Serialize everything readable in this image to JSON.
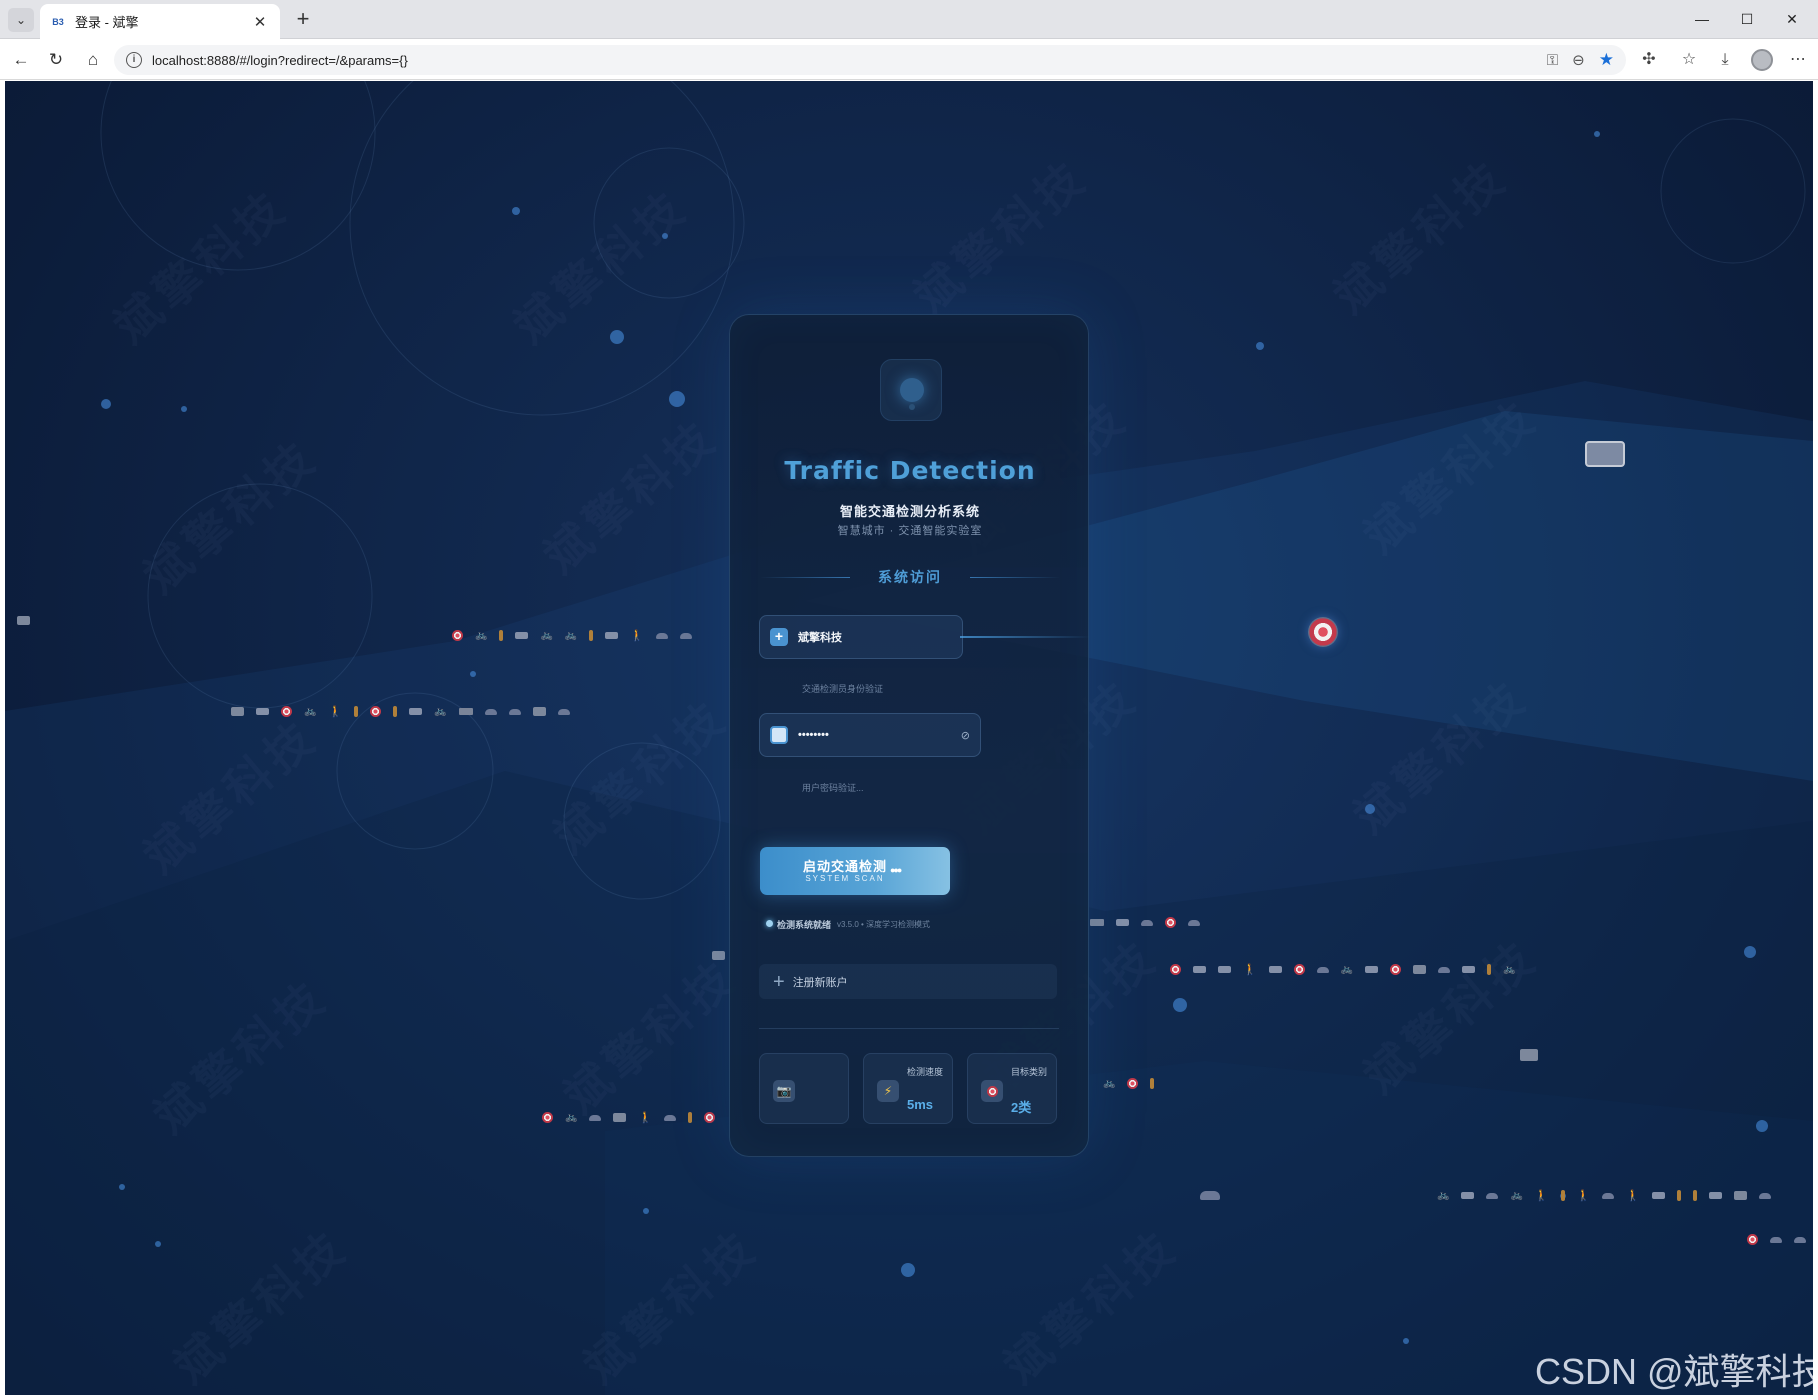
{
  "browser": {
    "tab_title": "登录 - 斌擎",
    "tab_favicon": "B3",
    "url": "localhost:8888/#/login?redirect=/&params={}"
  },
  "page": {
    "title": "Traffic Detection",
    "subtitle": "智能交通检测分析系统",
    "org": "智慧城市 · 交通智能实验室",
    "section_title": "系统访问",
    "username": {
      "value": "斌擎科技",
      "hint": "交通检测员身份验证"
    },
    "password": {
      "value": "••••••••",
      "hint": "用户密码验证..."
    },
    "submit": {
      "label": "启动交通检测",
      "sublabel": "SYSTEM SCAN",
      "dots": "●●●"
    },
    "status": {
      "text": "检测系统就绪",
      "version": "v3.5.0 • 深度学习检测模式"
    },
    "register_label": "注册新账户",
    "stats": [
      {
        "label": "",
        "value": ""
      },
      {
        "label": "检测速度",
        "value": "5ms"
      },
      {
        "label": "目标类别",
        "value": "2类"
      }
    ]
  },
  "background": {
    "watermark": "斌擎科技"
  },
  "footer_watermark": "CSDN @斌擎科技",
  "colors": {
    "accent": "#4fa0d8",
    "background": "#10264a",
    "button": "#58a4d6"
  },
  "icons": {
    "username": "plus-square-icon",
    "password": "lock-icon",
    "toggle": "eye-off-icon",
    "camera": "camera-icon",
    "speed": "lightning-icon",
    "target": "target-icon"
  }
}
